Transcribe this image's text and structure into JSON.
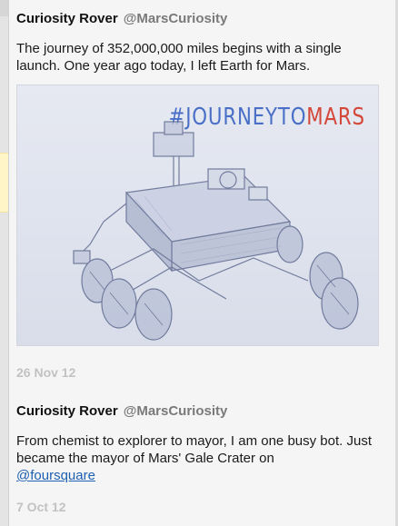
{
  "tweets": [
    {
      "name": "Curiosity Rover",
      "handle": "@MarsCuriosity",
      "text": "The journey of 352,000,000 miles begins with a single launch. One year ago today, I left Earth for Mars.",
      "media": {
        "hashtag_part1": "#JOURNEYTO",
        "hashtag_part2": "MARS",
        "colors": {
          "part1": "#4a6fc6",
          "part2": "#d4483a"
        }
      },
      "date": "26 Nov 12"
    },
    {
      "name": "Curiosity Rover",
      "handle": "@MarsCuriosity",
      "text": "From chemist to explorer to mayor, I am one busy bot. Just became the mayor of Mars' Gale Crater on",
      "link": "@foursquare",
      "date": "7 Oct 12"
    }
  ]
}
